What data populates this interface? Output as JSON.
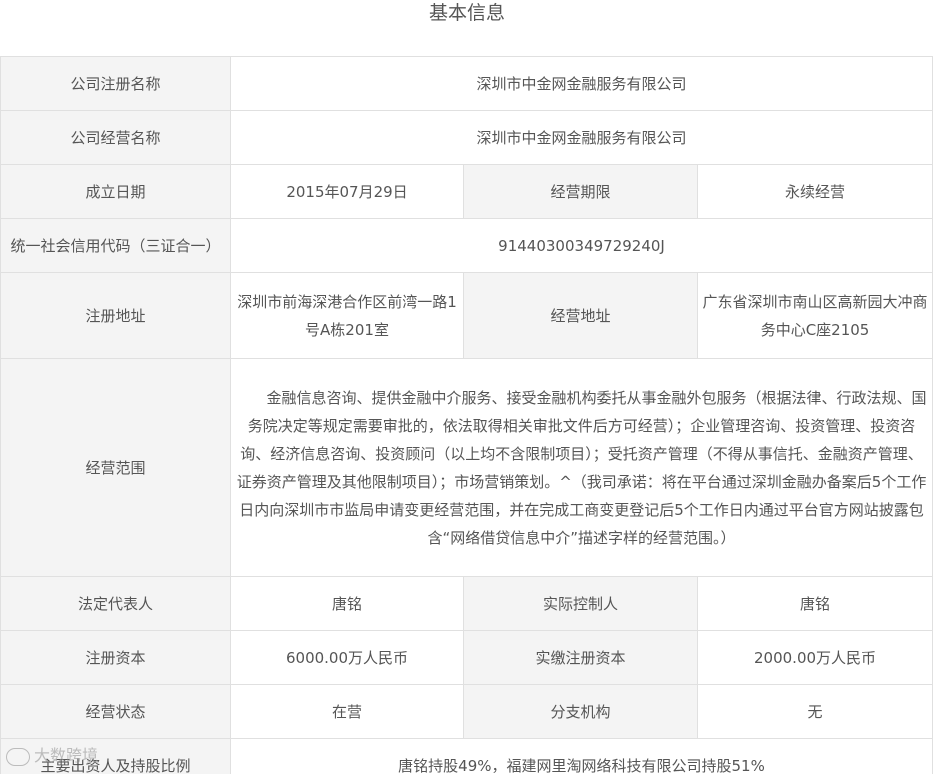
{
  "title": "基本信息",
  "rows": {
    "reg_name": {
      "label": "公司注册名称",
      "value": "深圳市中金网金融服务有限公司"
    },
    "op_name": {
      "label": "公司经营名称",
      "value": "深圳市中金网金融服务有限公司"
    },
    "founded": {
      "label": "成立日期",
      "value": "2015年07月29日"
    },
    "term": {
      "label": "经营期限",
      "value": "永续经营"
    },
    "credit_code": {
      "label": "统一社会信用代码（三证合一）",
      "value": "91440300349729240J"
    },
    "reg_address": {
      "label": "注册地址",
      "value": "深圳市前海深港合作区前湾一路1号A栋201室"
    },
    "op_address": {
      "label": "经营地址",
      "value": "广东省深圳市南山区高新园大冲商务中心C座2105"
    },
    "scope": {
      "label": "经营范围",
      "value": "金融信息咨询、提供金融中介服务、接受金融机构委托从事金融外包服务（根据法律、行政法规、国务院决定等规定需要审批的，依法取得相关审批文件后方可经营）；企业管理咨询、投资管理、投资咨询、经济信息咨询、投资顾问（以上均不含限制项目）；受托资产管理（不得从事信托、金融资产管理、证券资产管理及其他限制项目）；市场营销策划。^（我司承诺：将在平台通过深圳金融办备案后5个工作日内向深圳市市监局申请变更经营范围，并在完成工商变更登记后5个工作日内通过平台官方网站披露包含“网络借贷信息中介”描述字样的经营范围。）"
    },
    "legal_rep": {
      "label": "法定代表人",
      "value": "唐铭"
    },
    "controller": {
      "label": "实际控制人",
      "value": "唐铭"
    },
    "reg_capital": {
      "label": "注册资本",
      "value": "6000.00万人民币"
    },
    "paid_capital": {
      "label": "实缴注册资本",
      "value": "2000.00万人民币"
    },
    "status": {
      "label": "经营状态",
      "value": "在营"
    },
    "branch": {
      "label": "分支机构",
      "value": "无"
    },
    "shareholders": {
      "label": "主要出资人及持股比例",
      "value": "唐铭持股49%，福建网里淘网络科技有限公司持股51%"
    }
  },
  "watermark": "大数跨境"
}
